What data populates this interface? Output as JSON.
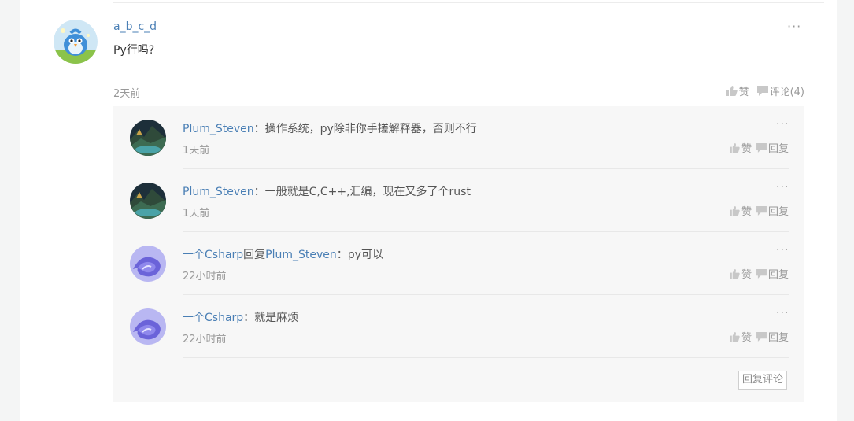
{
  "comment": {
    "username": "a_b_c_d",
    "content": "Py行吗?",
    "time": "2天前",
    "more_label": "···",
    "like_label": "赞",
    "comment_label": "评论(4)"
  },
  "replies": [
    {
      "user": "Plum_Steven",
      "reply_word": "",
      "target": "",
      "sep": "：",
      "text": "操作系统，py除非你手搓解释器，否则不行",
      "time": "1天前",
      "like": "赞",
      "reply": "回复",
      "more": "···",
      "avatar": "landscape"
    },
    {
      "user": "Plum_Steven",
      "reply_word": "",
      "target": "",
      "sep": "：",
      "text": "一般就是C,C++,汇编，现在又多了个rust",
      "time": "1天前",
      "like": "赞",
      "reply": "回复",
      "more": "···",
      "avatar": "landscape"
    },
    {
      "user": "一个Csharp",
      "reply_word": "回复",
      "target": "Plum_Steven",
      "sep": "：",
      "text": "py可以",
      "time": "22小时前",
      "like": "赞",
      "reply": "回复",
      "more": "···",
      "avatar": "swirl"
    },
    {
      "user": "一个Csharp",
      "reply_word": "",
      "target": "",
      "sep": "：",
      "text": "就是麻烦",
      "time": "22小时前",
      "like": "赞",
      "reply": "回复",
      "more": "···",
      "avatar": "swirl"
    }
  ],
  "reply_comment_button": "回复评论",
  "colors": {
    "link": "#4a7fb5",
    "muted": "#999999",
    "panel": "#f7f7f7"
  },
  "icons": {
    "like": "thumbs-up-icon",
    "comment": "speech-bubble-icon",
    "more": "ellipsis-icon"
  }
}
